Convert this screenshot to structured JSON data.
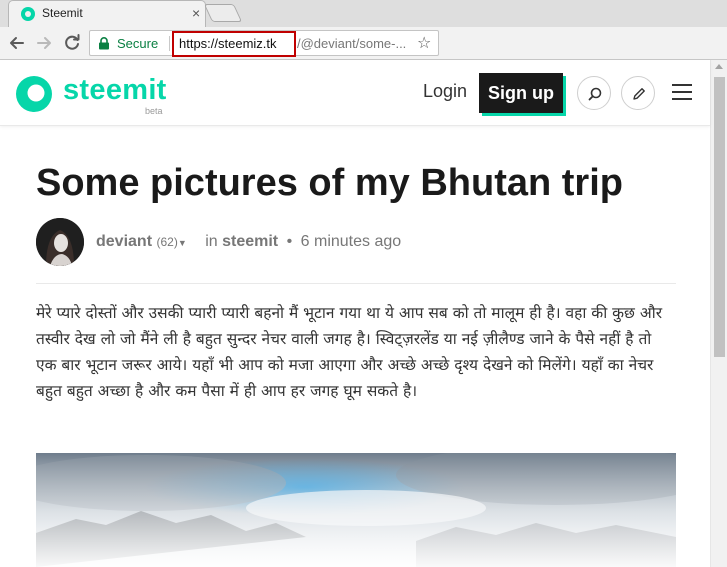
{
  "browser": {
    "tab": {
      "title": "Steemit",
      "close_glyph": "×"
    },
    "toolbar": {
      "security_label": "Secure",
      "url_highlighted": "https://steemiz.tk",
      "url_rest": "/@deviant/some-..."
    },
    "icons": [
      "back-icon",
      "forward-icon",
      "reload-icon",
      "lock-icon",
      "star-icon"
    ]
  },
  "site": {
    "logo_text": "steemit",
    "logo_badge": "beta",
    "login_label": "Login",
    "signup_label": "Sign up",
    "brand_color": "#06d6a9",
    "icons": [
      "search-icon",
      "pencil-icon",
      "hamburger-menu-icon"
    ]
  },
  "post": {
    "title": "Some pictures of my Bhutan trip",
    "author": "deviant",
    "reputation": "(62)",
    "in_label": "in",
    "category": "steemit",
    "separator": "•",
    "time": "6 minutes ago",
    "body": "मेरे प्यारे दोस्तों और उसकी प्यारी प्यारी बहनो मैं भूटान गया था ये आप सब को तो मालूम ही है।  वहा की कुछ और तस्वीर देख लो  जो मैंने ली है बहुत सुन्दर नेचर  वाली जगह है।  स्विट्ज़रलेंड या नई ज़ीलैण्ड जाने के पैसे नहीं है तो एक बार भूटान जरूर आये।  यहाँ भी आप को मजा आएगा और अच्छे अच्छे दृश्य देखने को मिलेंगे।  यहाँ का नेचर बहुत  बहुत अच्छा है और कम पैसा में ही आप हर जगह घूम सकते है।"
  }
}
